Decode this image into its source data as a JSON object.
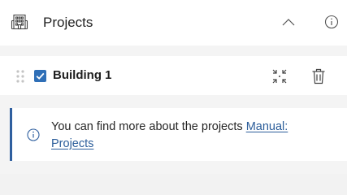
{
  "header": {
    "title": "Projects",
    "icons": {
      "building": "building-icon",
      "collapse": "chevron-up-icon",
      "info": "info-icon"
    }
  },
  "item": {
    "label": "Building 1",
    "checked": true,
    "icons": {
      "drag": "drag-handle-icon",
      "focus": "focus-icon",
      "delete": "trash-icon"
    }
  },
  "notice": {
    "text": "You can find more about the projects ",
    "link_line1": "Manual:",
    "link_line2": "Projects",
    "icon": "info-icon"
  },
  "colors": {
    "accent": "#2f6fb7",
    "link": "#2b5d9a",
    "notice_border": "#2f5f9f"
  }
}
